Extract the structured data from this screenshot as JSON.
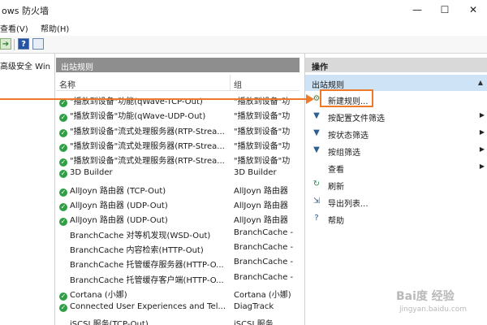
{
  "window": {
    "title": "ows 防火墙",
    "min_glyph": "—",
    "max_glyph": "☐",
    "close_glyph": "✕"
  },
  "menubar": {
    "view": "查看(V)",
    "help": "帮助(H)"
  },
  "left_tree": {
    "node": "高级安全 Win"
  },
  "center": {
    "header": "出站规则",
    "columns": {
      "name": "名称",
      "group": "组"
    },
    "rows": [
      {
        "name": "\"播放到设备\"功能(qWave-TCP-Out)",
        "group": "\"播放到设备\"功",
        "enabled": true
      },
      {
        "name": "\"播放到设备\"功能(qWave-UDP-Out)",
        "group": "\"播放到设备\"功",
        "enabled": true
      },
      {
        "name": "\"播放到设备\"流式处理服务器(RTP-Strea...",
        "group": "\"播放到设备\"功",
        "enabled": true
      },
      {
        "name": "\"播放到设备\"流式处理服务器(RTP-Strea...",
        "group": "\"播放到设备\"功",
        "enabled": true
      },
      {
        "name": "\"播放到设备\"流式处理服务器(RTP-Strea...",
        "group": "\"播放到设备\"功",
        "enabled": true
      },
      {
        "name": "3D Builder",
        "group": "3D Builder",
        "enabled": true
      },
      {
        "name": "AllJoyn 路由器 (TCP-Out)",
        "group": "AllJoyn 路由器",
        "enabled": true
      },
      {
        "name": "AllJoyn 路由器 (UDP-Out)",
        "group": "AllJoyn 路由器",
        "enabled": true
      },
      {
        "name": "AllJoyn 路由器 (UDP-Out)",
        "group": "AllJoyn 路由器",
        "enabled": true
      },
      {
        "name": "BranchCache 对等机发现(WSD-Out)",
        "group": "BranchCache -",
        "enabled": false
      },
      {
        "name": "BranchCache 内容检索(HTTP-Out)",
        "group": "BranchCache -",
        "enabled": false
      },
      {
        "name": "BranchCache 托管缓存服务器(HTTP-O...",
        "group": "BranchCache -",
        "enabled": false
      },
      {
        "name": "BranchCache 托管缓存客户端(HTTP-O...",
        "group": "BranchCache -",
        "enabled": false
      },
      {
        "name": "Cortana (小娜)",
        "group": "Cortana (小娜)",
        "enabled": true
      },
      {
        "name": "Connected User Experiences and Tel...",
        "group": "DiagTrack",
        "enabled": true
      },
      {
        "name": "iSCSI 服务(TCP-Out)",
        "group": "iSCSI 服务",
        "enabled": false
      }
    ]
  },
  "actions": {
    "header": "操作",
    "section": "出站规则",
    "items": [
      {
        "label": "新建规则...",
        "icon": "new-rule-icon",
        "glyph": "⚙",
        "color": "#4a7a3a",
        "submenu": false
      },
      {
        "label": "按配置文件筛选",
        "icon": "filter-icon",
        "glyph": "▼",
        "color": "#2f5f8f",
        "submenu": true
      },
      {
        "label": "按状态筛选",
        "icon": "filter-icon",
        "glyph": "▼",
        "color": "#2f5f8f",
        "submenu": true
      },
      {
        "label": "按组筛选",
        "icon": "filter-icon",
        "glyph": "▼",
        "color": "#2f5f8f",
        "submenu": true
      },
      {
        "label": "查看",
        "icon": "",
        "glyph": "",
        "color": "#2f5f8f",
        "submenu": true
      },
      {
        "label": "刷新",
        "icon": "refresh-icon",
        "glyph": "↻",
        "color": "#2e8b57",
        "submenu": false
      },
      {
        "label": "导出列表...",
        "icon": "export-icon",
        "glyph": "⇲",
        "color": "#2f5f8f",
        "submenu": false
      },
      {
        "label": "帮助",
        "icon": "help-icon",
        "glyph": "?",
        "color": "#2455a5",
        "submenu": false
      }
    ]
  },
  "watermark": {
    "main": "Bai度 经验",
    "sub": "jingyan.baidu.com"
  },
  "colors": {
    "accent": "#ec7a2a",
    "section_bg": "#cfe3f6",
    "header_bg": "#8e8e8e",
    "check": "#2ea043"
  }
}
